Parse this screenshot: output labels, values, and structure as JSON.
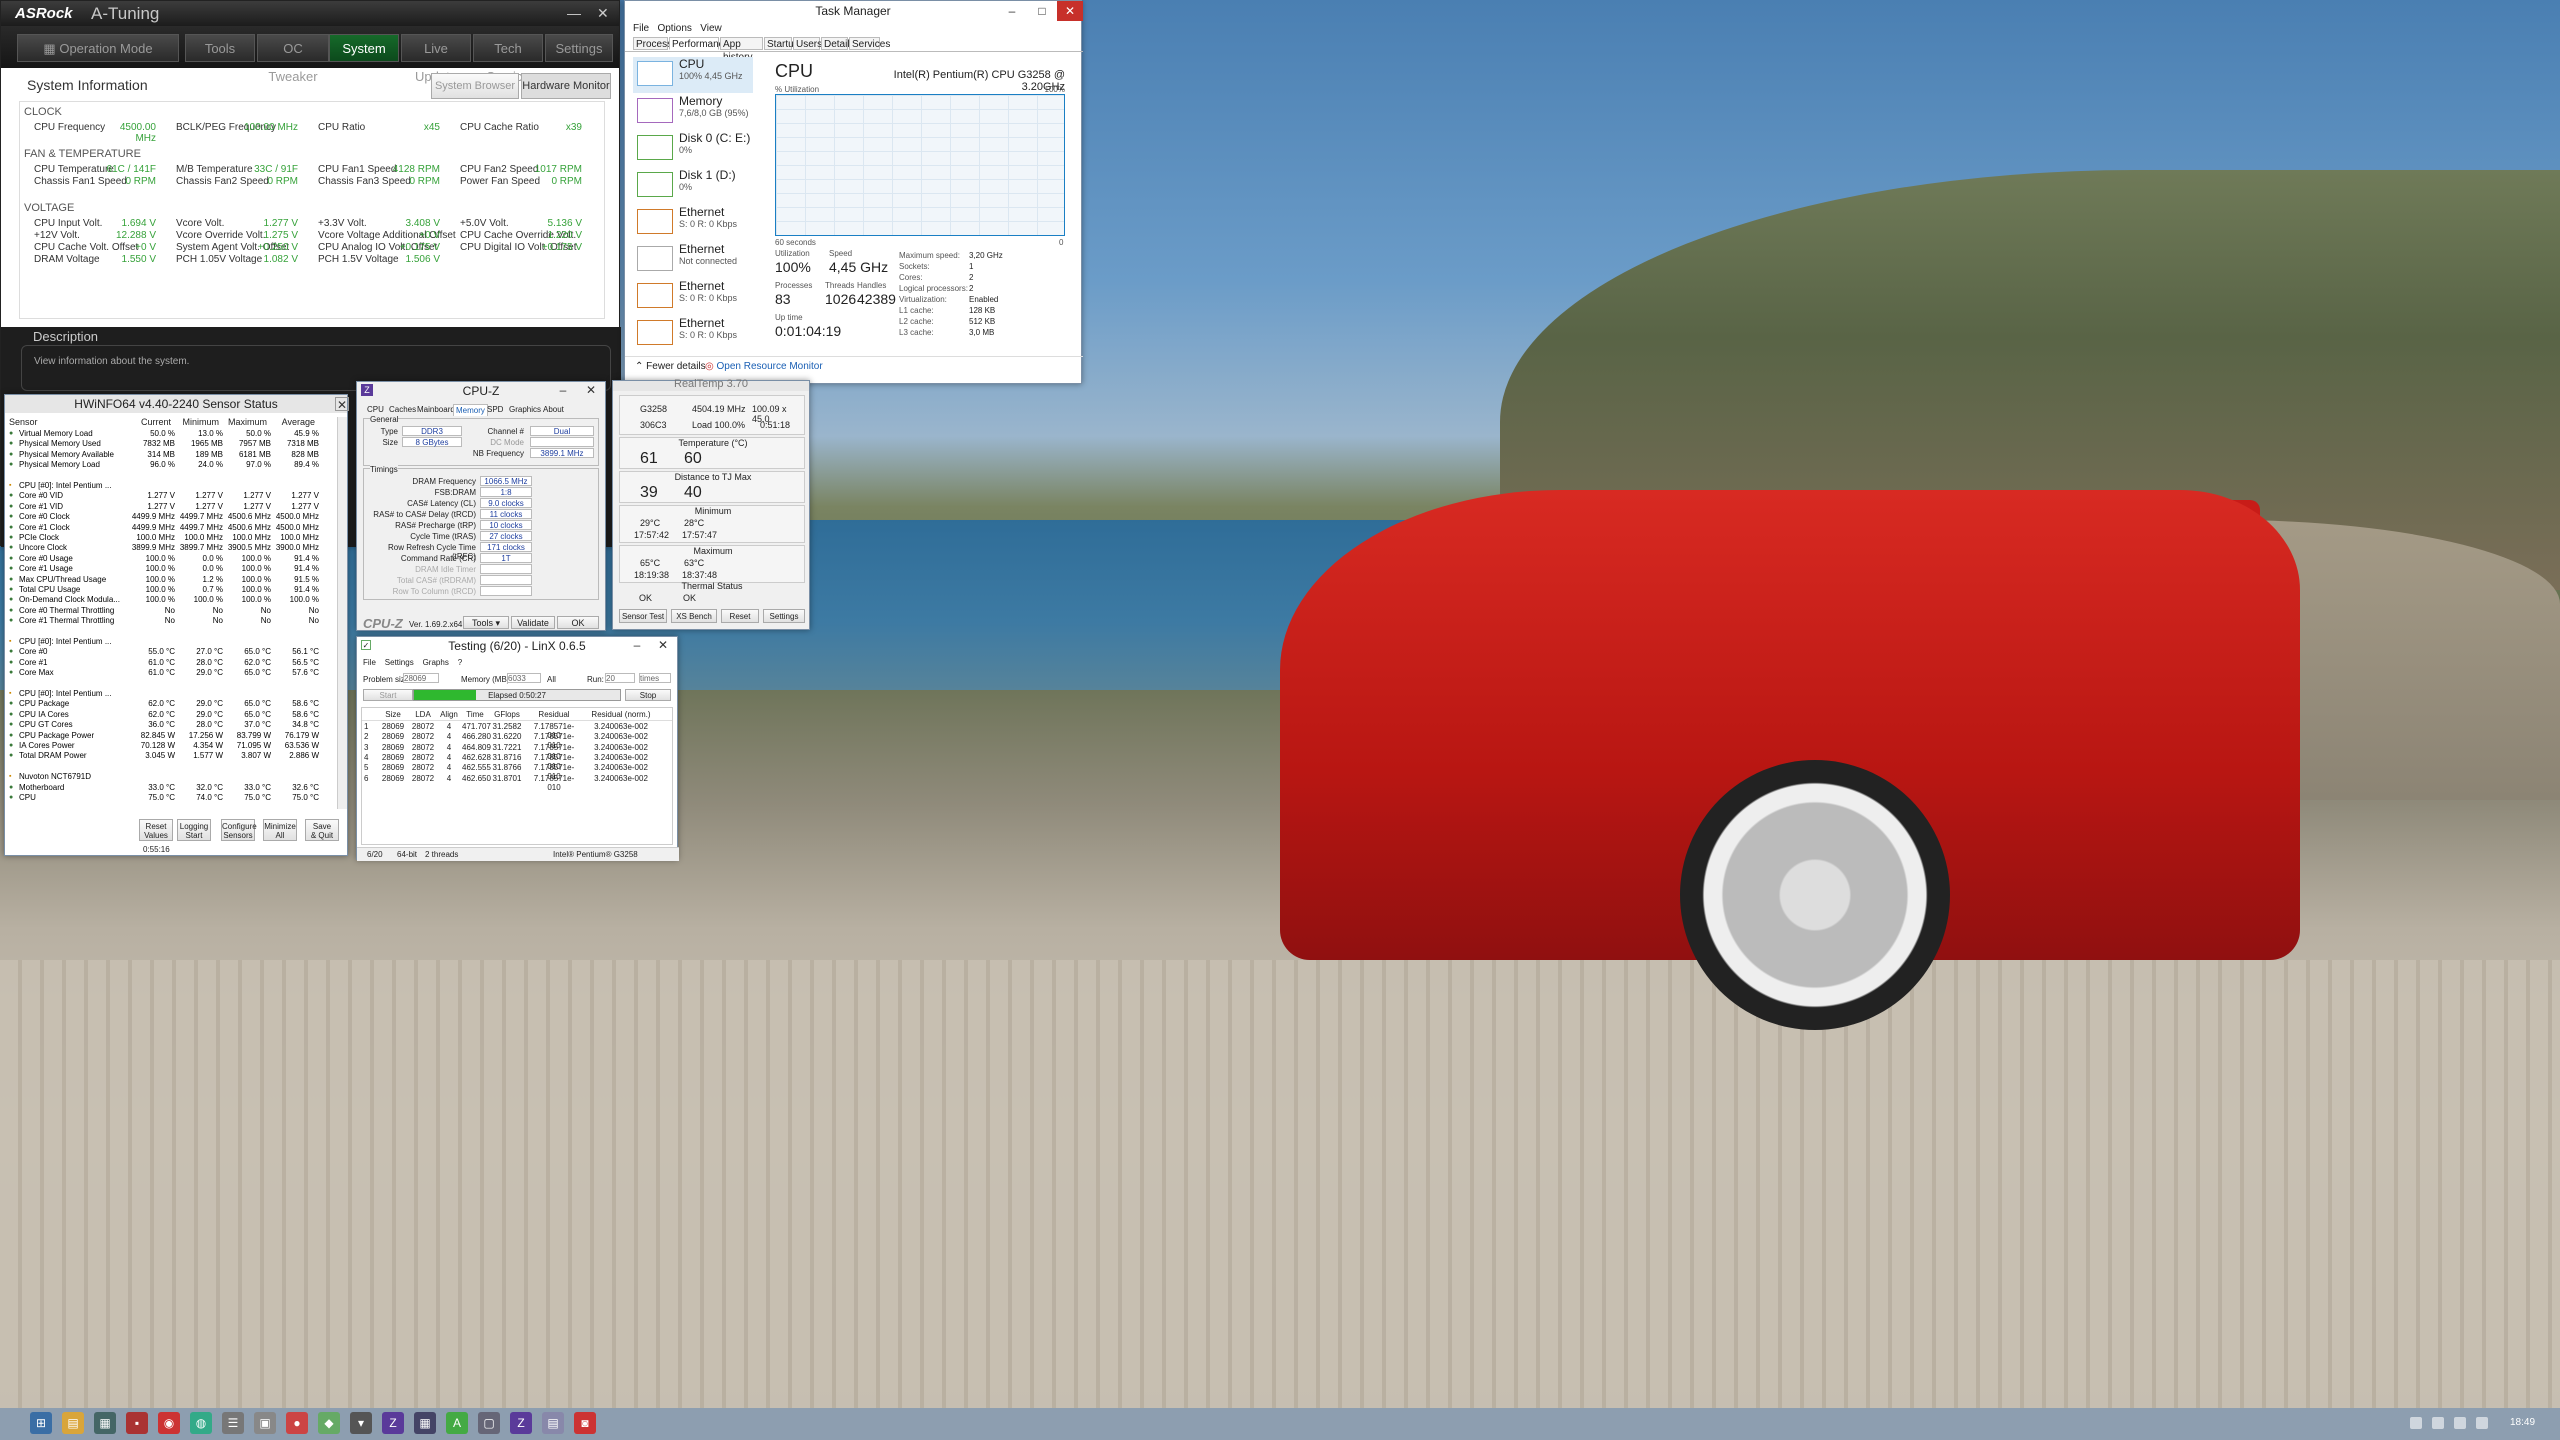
{
  "asrock": {
    "logo": "ASRock",
    "app": "A-Tuning",
    "min": "—",
    "close": "✕",
    "nav": [
      "Operation Mode",
      "Tools",
      "OC Tweaker",
      "System Info",
      "Live Update",
      "Tech Service",
      "Settings"
    ],
    "title": "System Information",
    "tab_browser": "System Browser",
    "tab_monitor": "Hardware Monitor",
    "clock": {
      "label": "CLOCK",
      "items": [
        [
          "CPU Frequency",
          "4500.00 MHz"
        ],
        [
          "BCLK/PEG Frequency",
          "100.00 MHz"
        ],
        [
          "CPU Ratio",
          "x45"
        ],
        [
          "CPU Cache Ratio",
          "x39"
        ]
      ]
    },
    "fan": {
      "label": "FAN & TEMPERATURE",
      "items": [
        [
          "CPU Temperature",
          "61C / 141F"
        ],
        [
          "M/B Temperature",
          "33C / 91F"
        ],
        [
          "CPU Fan1 Speed",
          "4128 RPM"
        ],
        [
          "CPU Fan2 Speed",
          "1017 RPM"
        ],
        [
          "Chassis Fan1 Speed",
          "0 RPM"
        ],
        [
          "Chassis Fan2 Speed",
          "0 RPM"
        ],
        [
          "Chassis Fan3 Speed",
          "0 RPM"
        ],
        [
          "Power Fan Speed",
          "0 RPM"
        ]
      ]
    },
    "volt": {
      "label": "VOLTAGE",
      "items": [
        [
          "CPU Input Volt.",
          "1.694 V"
        ],
        [
          "Vcore Volt.",
          "1.277 V"
        ],
        [
          "+3.3V Volt.",
          "3.408 V"
        ],
        [
          "+5.0V Volt.",
          "5.136 V"
        ],
        [
          "+12V Volt.",
          "12.288 V"
        ],
        [
          "Vcore Override Volt.",
          "1.275 V"
        ],
        [
          "Vcore Voltage Additional Offset",
          "+0 V"
        ],
        [
          "CPU Cache Override Volt.",
          "1.220 V"
        ],
        [
          "CPU Cache Volt. Offset",
          "+0 V"
        ],
        [
          "System Agent Volt. Offset",
          "+0.250 V"
        ],
        [
          "CPU Analog IO Volt. Offset",
          "+0.175 V"
        ],
        [
          "CPU Digital IO Volt. Offset",
          "+0.175 V"
        ],
        [
          "DRAM Voltage",
          "1.550 V"
        ],
        [
          "PCH 1.05V Voltage",
          "1.082 V"
        ],
        [
          "PCH 1.5V Voltage",
          "1.506 V"
        ]
      ]
    },
    "desc_title": "Description",
    "desc_text": "View information about the system."
  },
  "taskmgr": {
    "title": "Task Manager",
    "menu": [
      "File",
      "Options",
      "View"
    ],
    "tabs": [
      "Processes",
      "Performance",
      "App history",
      "Startup",
      "Users",
      "Details",
      "Services"
    ],
    "items": [
      {
        "name": "CPU",
        "sub": "100% 4,45 GHz"
      },
      {
        "name": "Memory",
        "sub": "7,6/8,0 GB (95%)"
      },
      {
        "name": "Disk 0 (C: E:)",
        "sub": "0%"
      },
      {
        "name": "Disk 1 (D:)",
        "sub": "0%"
      },
      {
        "name": "Ethernet",
        "sub": "S: 0 R: 0 Kbps"
      },
      {
        "name": "Ethernet",
        "sub": "Not connected"
      },
      {
        "name": "Ethernet",
        "sub": "S: 0 R: 0 Kbps"
      },
      {
        "name": "Ethernet",
        "sub": "S: 0 R: 0 Kbps"
      }
    ],
    "heading": "CPU",
    "cpu_name": "Intel(R) Pentium(R) CPU G3258 @ 3.20GHz",
    "util_label": "% Utilization",
    "max_label": "100%",
    "time_label": "60 seconds",
    "zero": "0",
    "stats": {
      "utilization_label": "Utilization",
      "utilization": "100%",
      "speed_label": "Speed",
      "speed": "4,45 GHz",
      "processes_label": "Processes",
      "processes": "83",
      "threads_label": "Threads",
      "threads": "1026",
      "handles_label": "Handles",
      "handles": "42389",
      "uptime_label": "Up time",
      "uptime": "0:01:04:19"
    },
    "right": [
      [
        "Maximum speed:",
        "3,20 GHz"
      ],
      [
        "Sockets:",
        "1"
      ],
      [
        "Cores:",
        "2"
      ],
      [
        "Logical processors:",
        "2"
      ],
      [
        "Virtualization:",
        "Enabled"
      ],
      [
        "L1 cache:",
        "128 KB"
      ],
      [
        "L2 cache:",
        "512 KB"
      ],
      [
        "L3 cache:",
        "3,0 MB"
      ]
    ],
    "fewer": "Fewer details",
    "resmon": "Open Resource Monitor"
  },
  "hwinfo": {
    "title": "HWiNFO64 v4.40-2240 Sensor Status",
    "cols": [
      "Sensor",
      "Current",
      "Minimum",
      "Maximum",
      "Average"
    ],
    "rows": [
      [
        "Virtual Memory Load",
        "50.0 %",
        "13.0 %",
        "50.0 %",
        "45.9 %"
      ],
      [
        "Physical Memory Used",
        "7832 MB",
        "1965 MB",
        "7957 MB",
        "7318 MB"
      ],
      [
        "Physical Memory Available",
        "314 MB",
        "189 MB",
        "6181 MB",
        "828 MB"
      ],
      [
        "Physical Memory Load",
        "96.0 %",
        "24.0 %",
        "97.0 %",
        "89.4 %"
      ],
      [
        "",
        "",
        "",
        "",
        ""
      ],
      [
        "CPU [#0]: Intel Pentium ...",
        "",
        "",
        "",
        ""
      ],
      [
        "Core #0 VID",
        "1.277 V",
        "1.277 V",
        "1.277 V",
        "1.277 V"
      ],
      [
        "Core #1 VID",
        "1.277 V",
        "1.277 V",
        "1.277 V",
        "1.277 V"
      ],
      [
        "Core #0 Clock",
        "4499.9 MHz",
        "4499.7 MHz",
        "4500.6 MHz",
        "4500.0 MHz"
      ],
      [
        "Core #1 Clock",
        "4499.9 MHz",
        "4499.7 MHz",
        "4500.6 MHz",
        "4500.0 MHz"
      ],
      [
        "PCIe Clock",
        "100.0 MHz",
        "100.0 MHz",
        "100.0 MHz",
        "100.0 MHz"
      ],
      [
        "Uncore Clock",
        "3899.9 MHz",
        "3899.7 MHz",
        "3900.5 MHz",
        "3900.0 MHz"
      ],
      [
        "Core #0 Usage",
        "100.0 %",
        "0.0 %",
        "100.0 %",
        "91.4 %"
      ],
      [
        "Core #1 Usage",
        "100.0 %",
        "0.0 %",
        "100.0 %",
        "91.4 %"
      ],
      [
        "Max CPU/Thread Usage",
        "100.0 %",
        "1.2 %",
        "100.0 %",
        "91.5 %"
      ],
      [
        "Total CPU Usage",
        "100.0 %",
        "0.7 %",
        "100.0 %",
        "91.4 %"
      ],
      [
        "On-Demand Clock Modula...",
        "100.0 %",
        "100.0 %",
        "100.0 %",
        "100.0 %"
      ],
      [
        "Core #0 Thermal Throttling",
        "No",
        "No",
        "No",
        "No"
      ],
      [
        "Core #1 Thermal Throttling",
        "No",
        "No",
        "No",
        "No"
      ],
      [
        "",
        "",
        "",
        "",
        ""
      ],
      [
        "CPU [#0]: Intel Pentium ...",
        "",
        "",
        "",
        ""
      ],
      [
        "Core #0",
        "55.0 °C",
        "27.0 °C",
        "65.0 °C",
        "56.1 °C"
      ],
      [
        "Core #1",
        "61.0 °C",
        "28.0 °C",
        "62.0 °C",
        "56.5 °C"
      ],
      [
        "Core Max",
        "61.0 °C",
        "29.0 °C",
        "65.0 °C",
        "57.6 °C"
      ],
      [
        "",
        "",
        "",
        "",
        ""
      ],
      [
        "CPU [#0]: Intel Pentium ...",
        "",
        "",
        "",
        ""
      ],
      [
        "CPU Package",
        "62.0 °C",
        "29.0 °C",
        "65.0 °C",
        "58.6 °C"
      ],
      [
        "CPU IA Cores",
        "62.0 °C",
        "29.0 °C",
        "65.0 °C",
        "58.6 °C"
      ],
      [
        "CPU GT Cores",
        "36.0 °C",
        "28.0 °C",
        "37.0 °C",
        "34.8 °C"
      ],
      [
        "CPU Package Power",
        "82.845 W",
        "17.256 W",
        "83.799 W",
        "76.179 W"
      ],
      [
        "IA Cores Power",
        "70.128 W",
        "4.354 W",
        "71.095 W",
        "63.536 W"
      ],
      [
        "Total DRAM Power",
        "3.045 W",
        "1.577 W",
        "3.807 W",
        "2.886 W"
      ],
      [
        "",
        "",
        "",
        "",
        ""
      ],
      [
        "Nuvoton NCT6791D",
        "",
        "",
        "",
        ""
      ],
      [
        "Motherboard",
        "33.0 °C",
        "32.0 °C",
        "33.0 °C",
        "32.6 °C"
      ],
      [
        "CPU",
        "75.0 °C",
        "74.0 °C",
        "75.0 °C",
        "75.0 °C"
      ]
    ],
    "buttons": [
      "Reset\nValues",
      "Logging\nStart",
      "Configure\nSensors",
      "Minimize\nAll",
      "Save\n& Quit"
    ],
    "time": "0:55:16"
  },
  "cpuz": {
    "title": "CPU-Z",
    "tabs": [
      "CPU",
      "Caches",
      "Mainboard",
      "Memory",
      "SPD",
      "Graphics",
      "About"
    ],
    "general": "General",
    "type_l": "Type",
    "type": "DDR3",
    "size_l": "Size",
    "size": "8 GBytes",
    "chan_l": "Channel #",
    "chan": "Dual",
    "dc_l": "DC Mode",
    "nb_l": "NB Frequency",
    "nb": "3899.1 MHz",
    "timings": "Timings",
    "t": [
      [
        "DRAM Frequency",
        "1066.5 MHz"
      ],
      [
        "FSB:DRAM",
        "1:8"
      ],
      [
        "CAS# Latency (CL)",
        "9.0 clocks"
      ],
      [
        "RAS# to CAS# Delay (tRCD)",
        "11 clocks"
      ],
      [
        "RAS# Precharge (tRP)",
        "10 clocks"
      ],
      [
        "Cycle Time (tRAS)",
        "27 clocks"
      ],
      [
        "Row Refresh Cycle Time (tRFC)",
        "171 clocks"
      ],
      [
        "Command Rate (CR)",
        "1T"
      ],
      [
        "DRAM Idle Timer",
        ""
      ],
      [
        "Total CAS# (tRDRAM)",
        ""
      ],
      [
        "Row To Column (tRCD)",
        ""
      ]
    ],
    "logo": "CPU-Z",
    "ver": "Ver. 1.69.2.x64",
    "tools": "Tools",
    "validate": "Validate",
    "ok": "OK"
  },
  "realtemp": {
    "title": "RealTemp 3.70",
    "cpu": "G3258",
    "freq": "4504.19 MHz",
    "mult": "100.09 x 45.0",
    "id": "306C3",
    "load": "Load 100.0%",
    "time": "0:51:18",
    "temp_l": "Temperature (°C)",
    "t1": "61",
    "t2": "60",
    "dist_l": "Distance to TJ Max",
    "d1": "39",
    "d2": "40",
    "min_l": "Minimum",
    "min1": "29°C",
    "min1t": "17:57:42",
    "min2": "28°C",
    "min2t": "17:57:47",
    "max_l": "Maximum",
    "max1": "65°C",
    "max1t": "18:19:38",
    "max2": "63°C",
    "max2t": "18:37:48",
    "thermal_l": "Thermal Status",
    "ok1": "OK",
    "ok2": "OK",
    "buttons": [
      "Sensor Test",
      "XS Bench",
      "Reset",
      "Settings"
    ]
  },
  "linx": {
    "title": "Testing (6/20) - LinX 0.6.5",
    "menu": [
      "File",
      "Settings",
      "Graphs",
      "?"
    ],
    "ps_l": "Problem size:",
    "ps": "28069",
    "mem_l": "Memory (MB):",
    "mem": "6033",
    "all": "All",
    "run_l": "Run:",
    "run": "20",
    "times": "times",
    "start": "Start",
    "elapsed": "Elapsed 0:50:27",
    "stop": "Stop",
    "cols": [
      "",
      "Size",
      "LDA",
      "Align",
      "Time",
      "GFlops",
      "Residual",
      "Residual (norm.)"
    ],
    "rows": [
      [
        "1",
        "28069",
        "28072",
        "4",
        "471.707",
        "31.2582",
        "7.178571e-010",
        "3.240063e-002"
      ],
      [
        "2",
        "28069",
        "28072",
        "4",
        "466.280",
        "31.6220",
        "7.178571e-010",
        "3.240063e-002"
      ],
      [
        "3",
        "28069",
        "28072",
        "4",
        "464.809",
        "31.7221",
        "7.178571e-010",
        "3.240063e-002"
      ],
      [
        "4",
        "28069",
        "28072",
        "4",
        "462.628",
        "31.8716",
        "7.178571e-010",
        "3.240063e-002"
      ],
      [
        "5",
        "28069",
        "28072",
        "4",
        "462.555",
        "31.8766",
        "7.178571e-010",
        "3.240063e-002"
      ],
      [
        "6",
        "28069",
        "28072",
        "4",
        "462.650",
        "31.8701",
        "7.178571e-010",
        "3.240063e-002"
      ]
    ],
    "status": [
      "6/20",
      "64-bit",
      "2 threads",
      "Intel® Pentium® G3258"
    ]
  },
  "taskbar": {
    "clock": "18:49"
  }
}
